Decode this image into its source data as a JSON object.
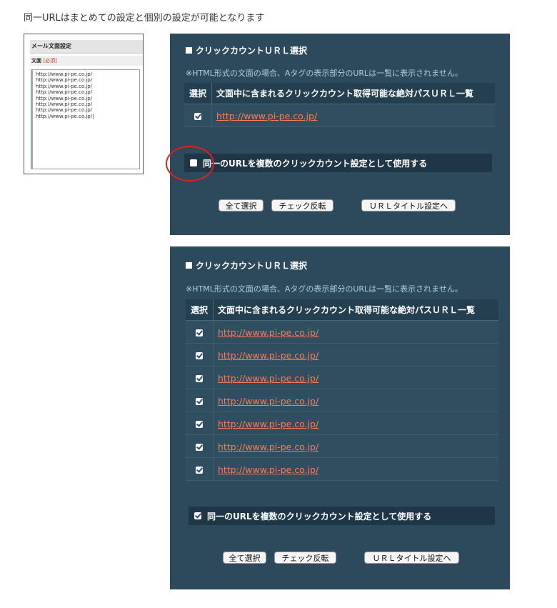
{
  "heading": "同一URLはまとめての設定と個別の設定が可能となります",
  "mail_panel": {
    "title": "メール文面設定",
    "field_label": "文面",
    "required": "[必須]",
    "body_lines": [
      "http://www.pi-pe.co.jp/",
      "http://www.pi-pe.co.jp/",
      "http://www.pi-pe.co.jp/",
      "http://www.pi-pe.co.jp/",
      "http://www.pi-pe.co.jp/",
      "http://www.pi-pe.co.jp/",
      "http://www.pi-pe.co.jp/",
      "http://www.pi-pe.co.jp/|"
    ]
  },
  "panel1": {
    "title": "クリックカウントＵＲＬ選択",
    "note": "※HTML形式の文面の場合、Aタグの表示部分のURLは一覧に表示されません。",
    "col_select": "選択",
    "col_url": "文面中に含まれるクリックカウント取得可能な絶対パスＵＲＬ一覧",
    "rows": [
      {
        "checked": true,
        "url": "http://www.pi-pe.co.jp/"
      }
    ],
    "same_url_label": "同一のURLを複数のクリックカウント設定として使用する",
    "same_url_checked": false,
    "btn_select_all": "全て選択",
    "btn_invert": "チェック反転",
    "btn_url_title": "ＵＲＬタイトル設定へ"
  },
  "panel2": {
    "title": "クリックカウントＵＲＬ選択",
    "note": "※HTML形式の文面の場合、Aタグの表示部分のURLは一覧に表示されません。",
    "col_select": "選択",
    "col_url": "文面中に含まれるクリックカウント取得可能な絶対パスＵＲＬ一覧",
    "rows": [
      {
        "checked": true,
        "url": "http://www.pi-pe.co.jp/"
      },
      {
        "checked": true,
        "url": "http://www.pi-pe.co.jp/"
      },
      {
        "checked": true,
        "url": "http://www.pi-pe.co.jp/"
      },
      {
        "checked": true,
        "url": "http://www.pi-pe.co.jp/"
      },
      {
        "checked": true,
        "url": "http://www.pi-pe.co.jp/"
      },
      {
        "checked": true,
        "url": "http://www.pi-pe.co.jp/"
      },
      {
        "checked": true,
        "url": "http://www.pi-pe.co.jp/"
      }
    ],
    "same_url_label": "同一のURLを複数のクリックカウント設定として使用する",
    "same_url_checked": true,
    "btn_select_all": "全て選択",
    "btn_invert": "チェック反転",
    "btn_url_title": "ＵＲＬタイトル設定へ"
  },
  "colors": {
    "panel_bg": "#2c4a5c",
    "link": "#ff7a55",
    "note": "#a9d4d8",
    "highlight_circle": "#e02020"
  }
}
